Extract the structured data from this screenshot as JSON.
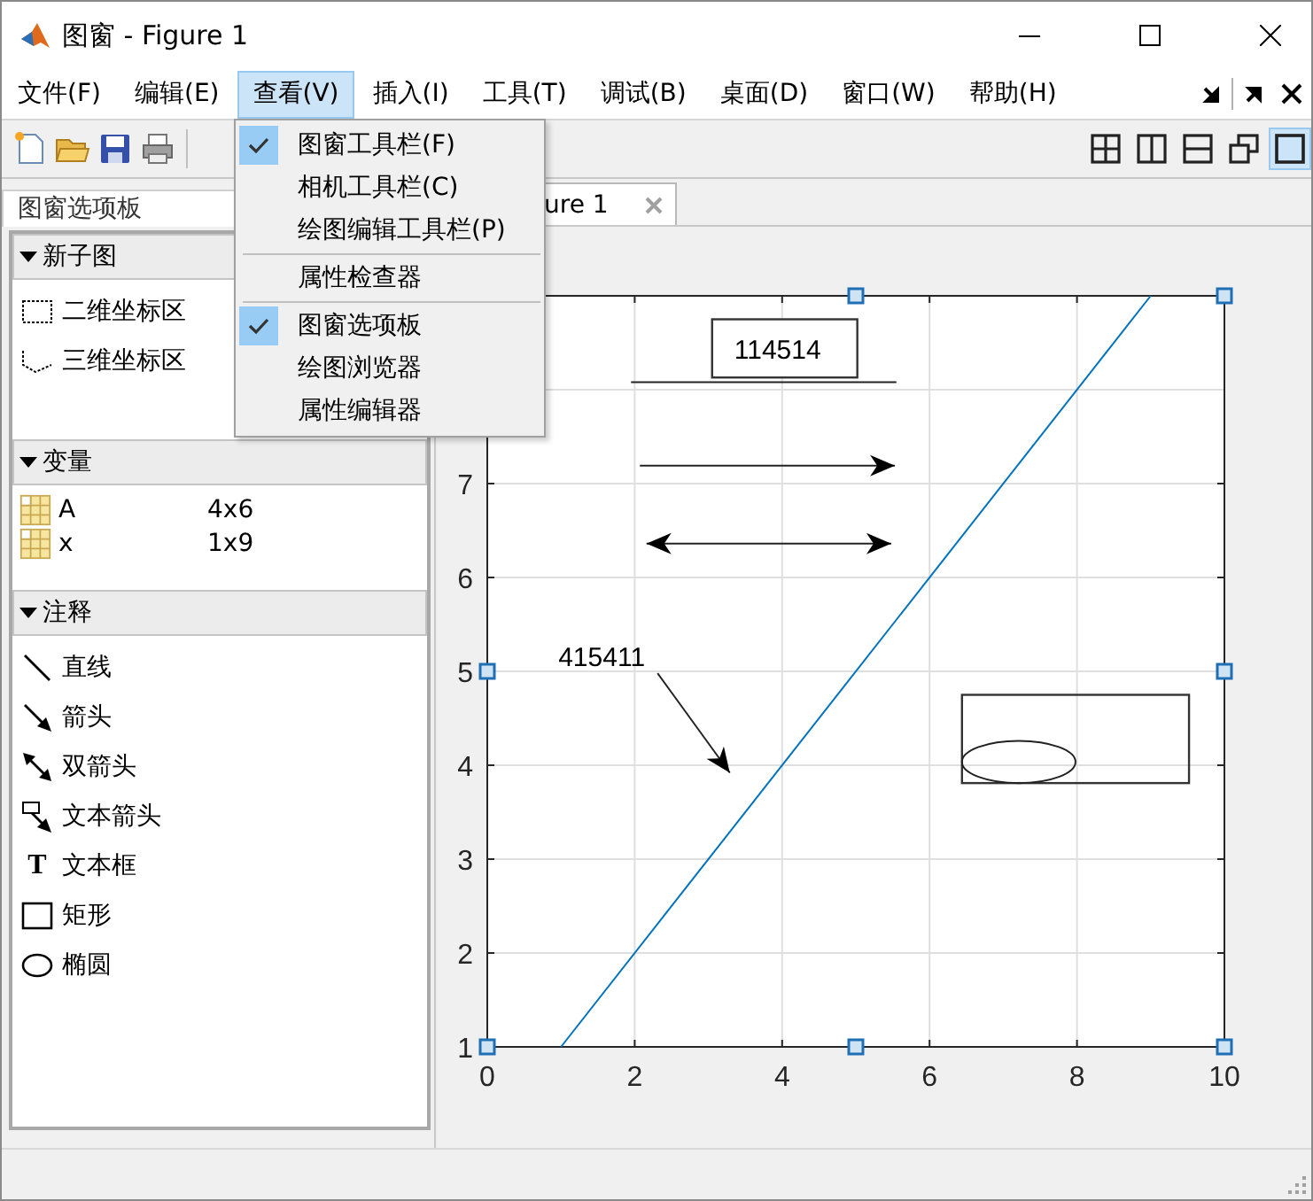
{
  "window": {
    "title": "图窗 - Figure 1"
  },
  "menu_bar": [
    {
      "label": "文件(F)",
      "selected": false
    },
    {
      "label": "编辑(E)",
      "selected": false
    },
    {
      "label": "查看(V)",
      "selected": true
    },
    {
      "label": "插入(I)",
      "selected": false
    },
    {
      "label": "工具(T)",
      "selected": false
    },
    {
      "label": "调试(B)",
      "selected": false
    },
    {
      "label": "桌面(D)",
      "selected": false
    },
    {
      "label": "窗口(W)",
      "selected": false
    },
    {
      "label": "帮助(H)",
      "selected": false
    }
  ],
  "view_menu": [
    {
      "kind": "item",
      "label": "图窗工具栏(F)",
      "checked": true
    },
    {
      "kind": "item",
      "label": "相机工具栏(C)",
      "checked": false
    },
    {
      "kind": "item",
      "label": "绘图编辑工具栏(P)",
      "checked": false
    },
    {
      "kind": "separator"
    },
    {
      "kind": "item",
      "label": "属性检查器",
      "checked": false
    },
    {
      "kind": "separator"
    },
    {
      "kind": "item",
      "label": "图窗选项板",
      "checked": true
    },
    {
      "kind": "item",
      "label": "绘图浏览器",
      "checked": false
    },
    {
      "kind": "item",
      "label": "属性编辑器",
      "checked": false
    }
  ],
  "layout_buttons": [
    {
      "kind": "grid",
      "selected": false
    },
    {
      "kind": "columns",
      "selected": false
    },
    {
      "kind": "rows",
      "selected": false
    },
    {
      "kind": "float",
      "selected": false
    },
    {
      "kind": "single",
      "selected": true
    }
  ],
  "palette": {
    "title": "图窗选项板",
    "sections": [
      {
        "title": "新子图",
        "expanded": true,
        "items": [
          {
            "kind": "axes2d",
            "label": "二维坐标区"
          },
          {
            "kind": "axes3d",
            "label": "三维坐标区"
          }
        ]
      },
      {
        "title": "变量",
        "expanded": true,
        "items": [
          {
            "kind": "variable",
            "label": "A",
            "size": "4x6"
          },
          {
            "kind": "variable",
            "label": "x",
            "size": "1x9"
          }
        ]
      },
      {
        "title": "注释",
        "expanded": true,
        "items": [
          {
            "kind": "line",
            "label": "直线"
          },
          {
            "kind": "arrow",
            "label": "箭头"
          },
          {
            "kind": "doublearrow",
            "label": "双箭头"
          },
          {
            "kind": "textarrow",
            "label": "文本箭头"
          },
          {
            "kind": "textbox",
            "glyph": "T",
            "label": "文本框"
          },
          {
            "kind": "rectangle",
            "label": "矩形"
          },
          {
            "kind": "ellipse",
            "label": "椭圆"
          }
        ]
      }
    ]
  },
  "figure_tabs": [
    {
      "label": "ure 1",
      "selected": true
    }
  ],
  "axes": {
    "selected": true,
    "chart_data": {
      "type": "line",
      "grid": true,
      "xlim": [
        0,
        10
      ],
      "ylim": [
        1,
        9
      ],
      "xticks": [
        0,
        2,
        4,
        6,
        8,
        10
      ],
      "yticks": [
        1,
        2,
        3,
        4,
        5,
        6,
        7
      ],
      "series": [
        {
          "color": "#0072bd",
          "x": [
            1,
            9
          ],
          "values": [
            1,
            9
          ]
        }
      ]
    },
    "annotations": [
      {
        "kind": "textbox",
        "text": "114514"
      },
      {
        "kind": "line"
      },
      {
        "kind": "arrow"
      },
      {
        "kind": "doublearrow"
      },
      {
        "kind": "textarrow",
        "text": "415411"
      },
      {
        "kind": "rectangle"
      },
      {
        "kind": "ellipse"
      }
    ]
  }
}
